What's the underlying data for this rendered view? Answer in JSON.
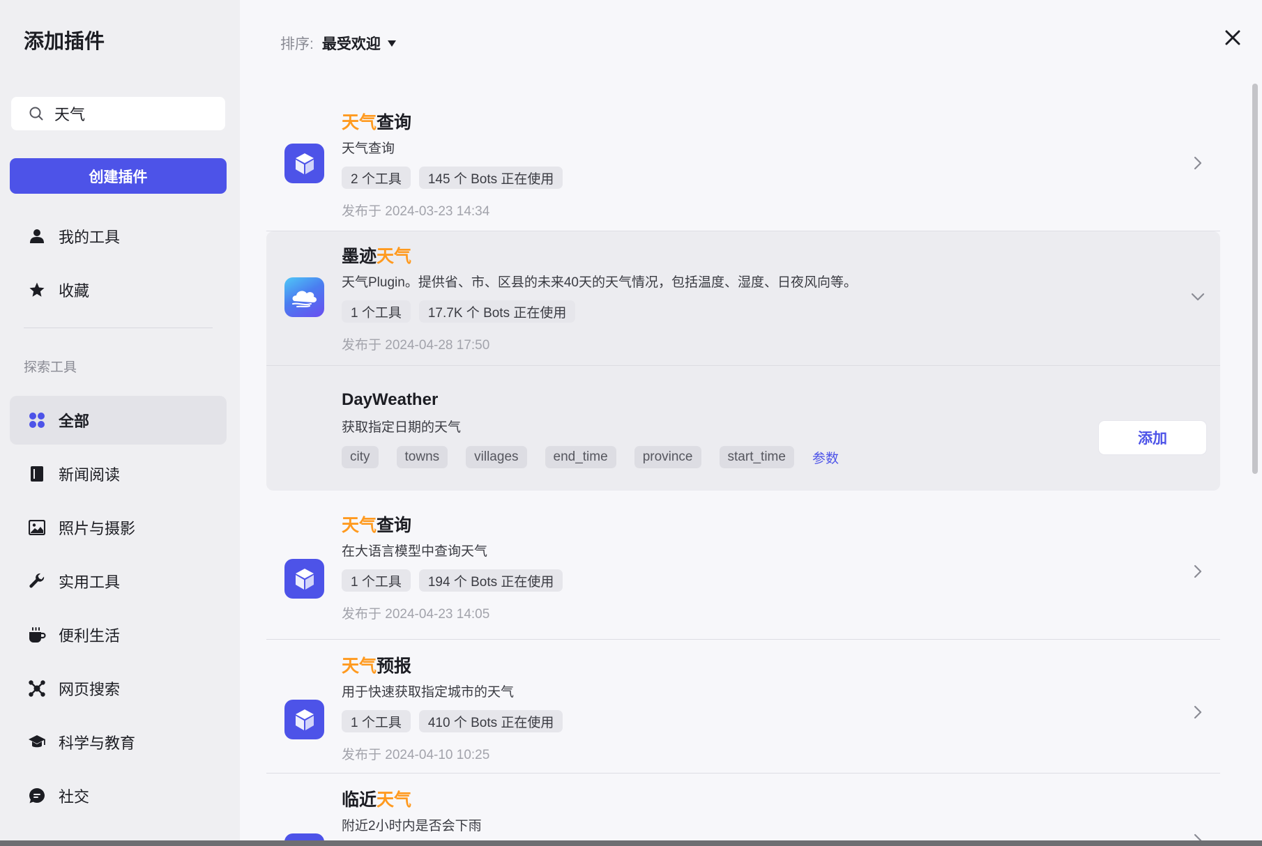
{
  "sidebar": {
    "title": "添加插件",
    "search": {
      "value": "天气",
      "icon": "search-icon"
    },
    "create_button": "创建插件",
    "top_items": [
      {
        "label": "我的工具",
        "icon": "user-icon"
      },
      {
        "label": "收藏",
        "icon": "star-icon"
      }
    ],
    "section_label": "探索工具",
    "categories": [
      {
        "label": "全部",
        "icon": "grid-icon",
        "active": true
      },
      {
        "label": "新闻阅读",
        "icon": "book-icon"
      },
      {
        "label": "照片与摄影",
        "icon": "image-icon"
      },
      {
        "label": "实用工具",
        "icon": "wrench-icon"
      },
      {
        "label": "便利生活",
        "icon": "cup-icon"
      },
      {
        "label": "网页搜索",
        "icon": "network-icon"
      },
      {
        "label": "科学与教育",
        "icon": "graduation-cap-icon"
      },
      {
        "label": "社交",
        "icon": "chat-icon"
      }
    ]
  },
  "main": {
    "sort": {
      "label": "排序:",
      "value": "最受欢迎"
    },
    "plugins": [
      {
        "title_highlight": "天气",
        "title_rest": "查询",
        "description": "天气查询",
        "tags": [
          "2 个工具",
          "145 个 Bots 正在使用"
        ],
        "date": "发布于 2024-03-23 14:34"
      },
      {
        "title_prefix": "墨迹",
        "title_highlight": "天气",
        "description": "天气Plugin。提供省、市、区县的未来40天的天气情况，包括温度、湿度、日夜风向等。",
        "tags": [
          "1 个工具",
          "17.7K 个 Bots 正在使用"
        ],
        "date": "发布于 2024-04-28 17:50",
        "expanded": true,
        "tool": {
          "name": "DayWeather",
          "description": "获取指定日期的天气",
          "params": [
            "city",
            "towns",
            "villages",
            "end_time",
            "province",
            "start_time"
          ],
          "params_link": "参数",
          "add_button": "添加"
        }
      },
      {
        "title_highlight": "天气",
        "title_rest": "查询",
        "description": "在大语言模型中查询天气",
        "tags": [
          "1 个工具",
          "194 个 Bots 正在使用"
        ],
        "date": "发布于 2024-04-23 14:05"
      },
      {
        "title_highlight": "天气",
        "title_rest": "预报",
        "description": "用于快速获取指定城市的天气",
        "tags": [
          "1 个工具",
          "410 个 Bots 正在使用"
        ],
        "date": "发布于 2024-04-10 10:25"
      },
      {
        "title_prefix": "临近",
        "title_highlight": "天气",
        "description": "附近2小时内是否会下雨"
      }
    ]
  }
}
